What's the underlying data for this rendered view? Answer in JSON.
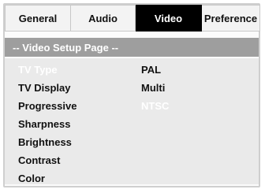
{
  "tabs": [
    {
      "label": "General",
      "active": false
    },
    {
      "label": "Audio",
      "active": false
    },
    {
      "label": "Video",
      "active": true
    },
    {
      "label": "Preference",
      "active": false
    }
  ],
  "page_title": "-- Video Setup Page --",
  "menu_items": [
    {
      "label": "TV Type",
      "highlighted": true
    },
    {
      "label": "TV Display",
      "highlighted": false
    },
    {
      "label": "Progressive",
      "highlighted": false
    },
    {
      "label": "Sharpness",
      "highlighted": false
    },
    {
      "label": "Brightness",
      "highlighted": false
    },
    {
      "label": "Contrast",
      "highlighted": false
    },
    {
      "label": "Color",
      "highlighted": false
    }
  ],
  "options": [
    {
      "label": "PAL",
      "highlighted": false
    },
    {
      "label": "Multi",
      "highlighted": false
    },
    {
      "label": "NTSC",
      "highlighted": true
    }
  ],
  "colors": {
    "active_tab_bg": "#000000",
    "header_bar_bg": "#9e9e9e",
    "content_bg": "#eaeaea",
    "highlight_text": "#ffffff"
  }
}
